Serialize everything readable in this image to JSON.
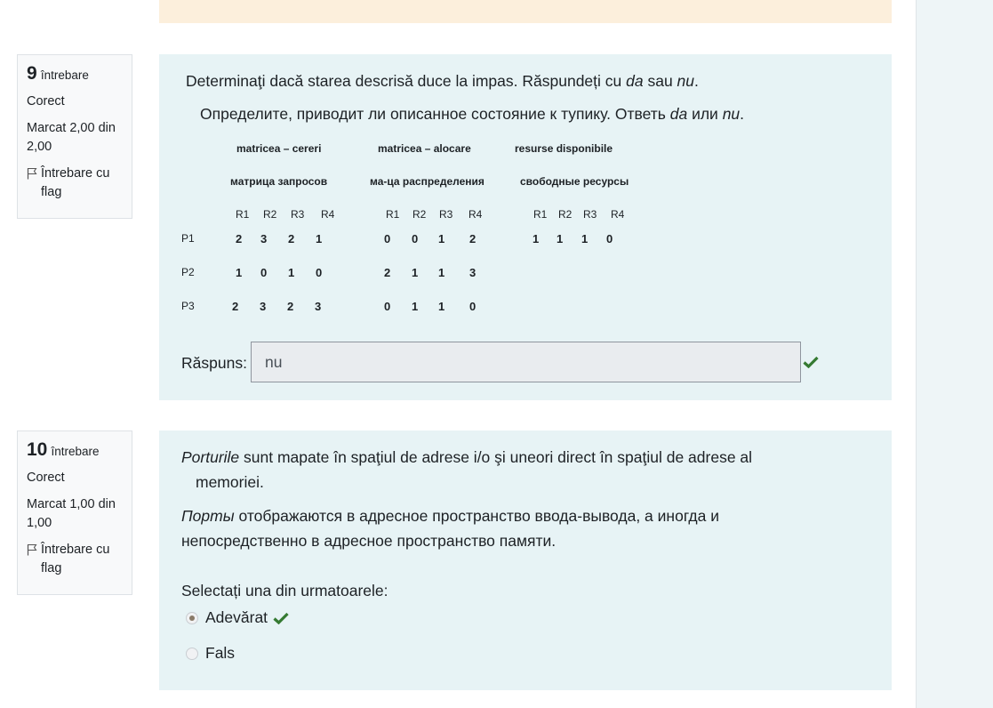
{
  "q9": {
    "number": "9",
    "word": "întrebare",
    "status": "Corect",
    "mark": "Marcat 2,00 din 2,00",
    "flag": "Întrebare cu flag",
    "text_ro_1": "Determinaţi dacă starea descrisă duce la impas. Răspundeți cu ",
    "text_ro_da": "da",
    "text_ro_2": " sau ",
    "text_ro_nu": "nu",
    "text_ro_3": ".",
    "text_ru_1": "Определите, приводит ли описанное состояние к тупику. Ответь ",
    "text_ru_da": "da",
    "text_ru_2": " или ",
    "text_ru_nu": "nu",
    "text_ru_3": ".",
    "table": {
      "head_ro": [
        "matricea – cereri",
        "matricea – alocare",
        "resurse disponibile"
      ],
      "head_ru": [
        "матрица запросов",
        "ма-ца распределения",
        "свободные ресурсы"
      ],
      "resources": [
        "R1",
        "R2",
        "R3",
        "R4"
      ],
      "processes": [
        "P1",
        "P2",
        "P3"
      ],
      "requests": [
        [
          "2",
          "3",
          "2",
          "1"
        ],
        [
          "1",
          "0",
          "1",
          "0"
        ],
        [
          "2",
          "3",
          "2",
          "3"
        ]
      ],
      "allocation": [
        [
          "0",
          "0",
          "1",
          "2"
        ],
        [
          "2",
          "1",
          "1",
          "3"
        ],
        [
          "0",
          "1",
          "1",
          "0"
        ]
      ],
      "available": [
        "1",
        "1",
        "1",
        "0"
      ]
    },
    "answer_label": "Răspuns:",
    "answer_value": "nu"
  },
  "q10": {
    "number": "10",
    "word": "întrebare",
    "status": "Corect",
    "mark": "Marcat 1,00 din 1,00",
    "flag": "Întrebare cu flag",
    "text_ro_em": "Porturile",
    "text_ro_rest": " sunt mapate în spaţiul de adrese i/o şi uneori direct în spaţiul de adrese al",
    "text_ro_rest2": "memoriei.",
    "text_ru_em": "Порты",
    "text_ru_rest": " отображаются в адресное пространство ввода-вывода, а иногда и",
    "text_ru_rest2": "непосредственно в адресное пространство памяти.",
    "prompt": "Selectați una din urmatoarele:",
    "options": [
      {
        "label": "Adevărat",
        "selected": true,
        "correct": true
      },
      {
        "label": "Fals",
        "selected": false
      }
    ]
  },
  "colors": {
    "correct": "#357a32",
    "content_bg": "#e7f3f5",
    "feedback_bg": "#fcefdc"
  }
}
